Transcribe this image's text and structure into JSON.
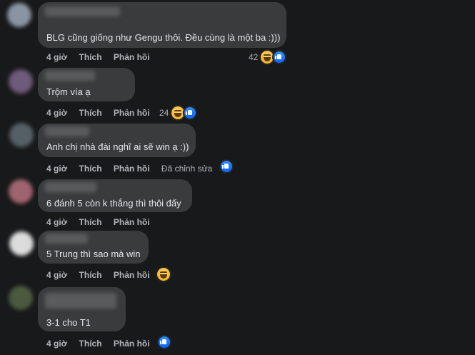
{
  "comments": [
    {
      "text": "BLG cũng giống như Gengu thôi. Đều cùng là một ba :)))",
      "time": "4 giờ",
      "like": "Thích",
      "reply": "Phản hồi",
      "reaction_count": "42"
    },
    {
      "text": "Trộm vía ạ",
      "time": "4 giờ",
      "like": "Thích",
      "reply": "Phản hồi",
      "reaction_count": "24"
    },
    {
      "text": "Anh chị nhà đài nghĩ ai sẽ win ạ :))",
      "time": "4 giờ",
      "like": "Thích",
      "reply": "Phản hồi",
      "edited": "Đã chỉnh sửa"
    },
    {
      "text": "6 đánh 5 còn k thắng thì thôi đấy",
      "time": "4 giờ",
      "like": "Thích",
      "reply": "Phản hồi"
    },
    {
      "text": "5 Trung thì sao mà win",
      "time": "4 giờ",
      "like": "Thích",
      "reply": "Phản hồi"
    },
    {
      "text": "3-1 cho T1",
      "time": "4 giờ",
      "like": "Thích",
      "reply": "Phản hồi"
    }
  ],
  "icons": {
    "haha": "haha-reaction-icon",
    "like": "like-reaction-icon"
  },
  "colors": {
    "background": "#18191a",
    "bubble": "#3a3b3c",
    "like_blue": "#0866ff"
  }
}
